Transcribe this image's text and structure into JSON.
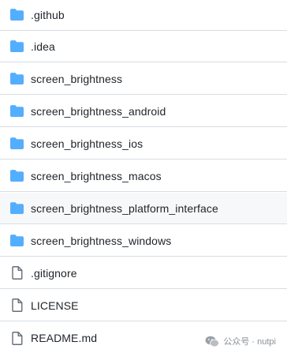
{
  "files": [
    {
      "name": ".github",
      "type": "folder"
    },
    {
      "name": ".idea",
      "type": "folder"
    },
    {
      "name": "screen_brightness",
      "type": "folder"
    },
    {
      "name": "screen_brightness_android",
      "type": "folder"
    },
    {
      "name": "screen_brightness_ios",
      "type": "folder"
    },
    {
      "name": "screen_brightness_macos",
      "type": "folder"
    },
    {
      "name": "screen_brightness_platform_interface",
      "type": "folder",
      "highlighted": true
    },
    {
      "name": "screen_brightness_windows",
      "type": "folder"
    },
    {
      "name": ".gitignore",
      "type": "file"
    },
    {
      "name": "LICENSE",
      "type": "file"
    },
    {
      "name": "README.md",
      "type": "file"
    }
  ],
  "icons": {
    "folder": "folder-icon",
    "file": "file-icon"
  },
  "colors": {
    "folder": "#54aeff",
    "file_stroke": "#656d76",
    "text": "#1f2328",
    "border": "#d8dee4",
    "hover_bg": "#f6f8fa"
  },
  "watermark": {
    "text": "公众号 · nutpi",
    "icon": "wechat-logo-icon"
  }
}
